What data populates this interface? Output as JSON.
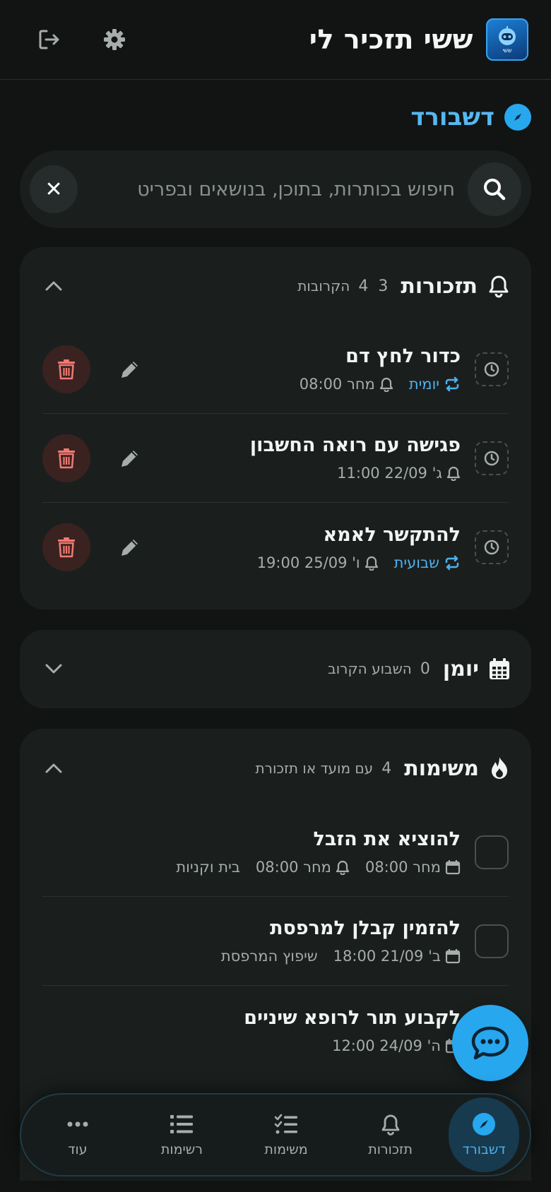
{
  "app": {
    "title": "ששי תזכיר לי",
    "logo_caption": "ששי",
    "icons": {
      "logout": "logout-icon",
      "settings": "gear-icon"
    }
  },
  "page": {
    "title": "דשבורד",
    "icon": "compass-icon"
  },
  "search": {
    "placeholder": "חיפוש בכותרות, בתוכן, בנושאים ובפריט",
    "value": "",
    "clear_label": "✕"
  },
  "reminders": {
    "title": "תזכורות",
    "count": "3",
    "count_secondary": "4",
    "subtitle": "הקרובות",
    "expanded": true,
    "items": [
      {
        "title": "כדור לחץ דם",
        "recurrence": "יומית",
        "when": "מחר 08:00"
      },
      {
        "title": "פגישה עם רואה החשבון",
        "recurrence": "",
        "when": "ג' 22/09 11:00"
      },
      {
        "title": "להתקשר לאמא",
        "recurrence": "שבועית",
        "when": "ו' 25/09 19:00"
      }
    ]
  },
  "calendar": {
    "title": "יומן",
    "count": "0",
    "subtitle": "השבוע הקרוב",
    "expanded": false
  },
  "tasks": {
    "title": "משימות",
    "count": "4",
    "subtitle": "עם מועד או תזכורת",
    "expanded": true,
    "items": [
      {
        "title": "להוציא את הזבל",
        "due": "מחר 08:00",
        "reminder": "מחר 08:00",
        "list": "בית וקניות"
      },
      {
        "title": "להזמין קבלן למרפסת",
        "due": "ב' 21/09 18:00",
        "reminder": "",
        "list": "שיפוץ המרפסת"
      },
      {
        "title": "לקבוע תור לרופא שיניים",
        "due": "ה' 24/09 12:00",
        "reminder": "",
        "list": ""
      }
    ]
  },
  "nav": {
    "items": [
      {
        "label": "דשבורד",
        "icon": "compass-icon",
        "active": true
      },
      {
        "label": "תזכורות",
        "icon": "bell-icon",
        "active": false
      },
      {
        "label": "משימות",
        "icon": "checklist-icon",
        "active": false
      },
      {
        "label": "רשימות",
        "icon": "list-icon",
        "active": false
      },
      {
        "label": "עוד",
        "icon": "more-icon",
        "active": false
      }
    ]
  },
  "colors": {
    "background": "#111413",
    "card": "#1a1f1e",
    "accent": "#27a7ee",
    "accent_text": "#4fb1ee",
    "danger": "#f07a72",
    "danger_bg": "#3a2221"
  }
}
